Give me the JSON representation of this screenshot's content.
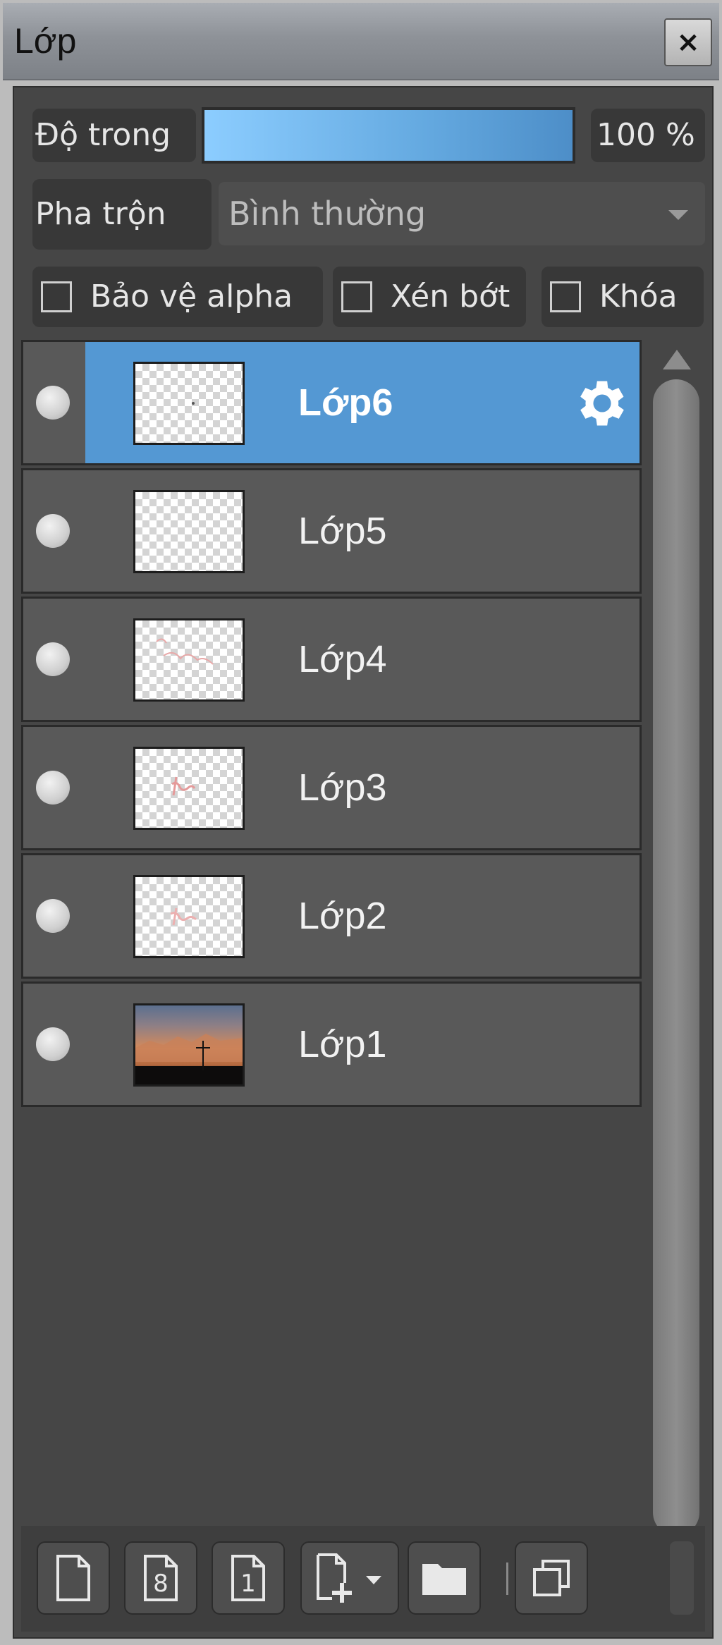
{
  "window": {
    "title": "Lớp",
    "close_glyph": "×"
  },
  "controls": {
    "opacity_label": "Độ trong",
    "opacity_value": "100 %",
    "opacity_fraction": 1.0,
    "blend_label": "Pha trộn",
    "blend_mode": "Bình thường",
    "checkboxes": [
      {
        "label": "Bảo vệ alpha",
        "checked": false
      },
      {
        "label": "Xén bớt",
        "checked": false
      },
      {
        "label": "Khóa",
        "checked": false
      }
    ]
  },
  "layers": [
    {
      "name": "Lớp6",
      "selected": true,
      "thumb": "transparent-dot",
      "has_gear": true
    },
    {
      "name": "Lớp5",
      "selected": false,
      "thumb": "transparent-empty"
    },
    {
      "name": "Lớp4",
      "selected": false,
      "thumb": "transparent-sketch"
    },
    {
      "name": "Lớp3",
      "selected": false,
      "thumb": "transparent-sketch"
    },
    {
      "name": "Lớp2",
      "selected": false,
      "thumb": "transparent-sketch"
    },
    {
      "name": "Lớp1",
      "selected": false,
      "thumb": "photo-sunset"
    }
  ],
  "toolbar": {
    "buttons": [
      {
        "icon": "new-layer-icon"
      },
      {
        "icon": "new-8bit-layer-icon",
        "glyph": "8"
      },
      {
        "icon": "new-1bit-layer-icon",
        "glyph": "1"
      },
      {
        "icon": "add-layer-menu-icon"
      },
      {
        "icon": "folder-icon"
      },
      {
        "icon": "duplicate-layer-icon"
      }
    ]
  },
  "colors": {
    "selection": "#5498d3",
    "opacity_fill": "#64a9e0",
    "panel_bg": "#464646"
  }
}
